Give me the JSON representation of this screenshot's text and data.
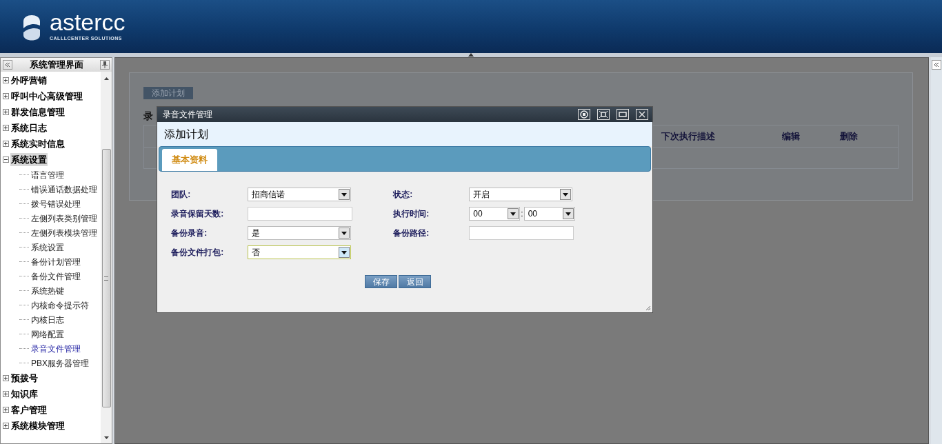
{
  "header": {
    "logo_text": "astercc",
    "logo_tagline": "CALLLCENTER SOLUTIONS"
  },
  "sidebar": {
    "title": "系统管理界面",
    "items": [
      {
        "label": "外呼营销",
        "expanded": false,
        "selected": false
      },
      {
        "label": "呼叫中心高级管理",
        "expanded": false,
        "selected": false
      },
      {
        "label": "群发信息管理",
        "expanded": false,
        "selected": false
      },
      {
        "label": "系统日志",
        "expanded": false,
        "selected": false
      },
      {
        "label": "系统实时信息",
        "expanded": false,
        "selected": false
      },
      {
        "label": "系统设置",
        "expanded": true,
        "selected": true,
        "children": [
          {
            "label": "语言管理",
            "selected": false
          },
          {
            "label": "错误通话数据处理",
            "selected": false
          },
          {
            "label": "拨号错误处理",
            "selected": false
          },
          {
            "label": "左侧列表类别管理",
            "selected": false
          },
          {
            "label": "左侧列表模块管理",
            "selected": false
          },
          {
            "label": "系统设置",
            "selected": false
          },
          {
            "label": "备份计划管理",
            "selected": false
          },
          {
            "label": "备份文件管理",
            "selected": false
          },
          {
            "label": "系统热键",
            "selected": false
          },
          {
            "label": "内核命令提示符",
            "selected": false
          },
          {
            "label": "内核日志",
            "selected": false
          },
          {
            "label": "网络配置",
            "selected": false
          },
          {
            "label": "录音文件管理",
            "selected": true
          },
          {
            "label": "PBX服务器管理",
            "selected": false
          }
        ]
      },
      {
        "label": "预拨号",
        "expanded": false,
        "selected": false
      },
      {
        "label": "知识库",
        "expanded": false,
        "selected": false
      },
      {
        "label": "客户管理",
        "expanded": false,
        "selected": false
      },
      {
        "label": "系统模块管理",
        "expanded": false,
        "selected": false
      }
    ]
  },
  "main": {
    "add_button": "添加计划",
    "section_title": "录",
    "table": {
      "columns": [
        "下次执行描述",
        "编辑",
        "删除"
      ]
    }
  },
  "dialog": {
    "title": "录音文件管理",
    "heading": "添加计划",
    "tabs": [
      {
        "label": "基本资料",
        "selected": true
      }
    ],
    "left_fields": [
      {
        "label": "团队:",
        "kind": "select",
        "value": "招商信诺",
        "focused": false
      },
      {
        "label": "录音保留天数:",
        "kind": "text",
        "focused": false
      },
      {
        "label": "备份录音:",
        "kind": "select",
        "value": "是",
        "focused": false
      },
      {
        "label": "备份文件打包:",
        "kind": "select",
        "value": "否",
        "focused": true
      }
    ],
    "right_fields": [
      {
        "label": "状态:",
        "kind": "select",
        "value": "开启",
        "focused": false
      },
      {
        "label": "执行时间:",
        "kind": "time",
        "hour": "00",
        "separator": ":",
        "minute": "00",
        "focused": false
      },
      {
        "label": "备份路径:",
        "kind": "text",
        "focused": false
      }
    ],
    "buttons": [
      "保存",
      "返回"
    ]
  }
}
